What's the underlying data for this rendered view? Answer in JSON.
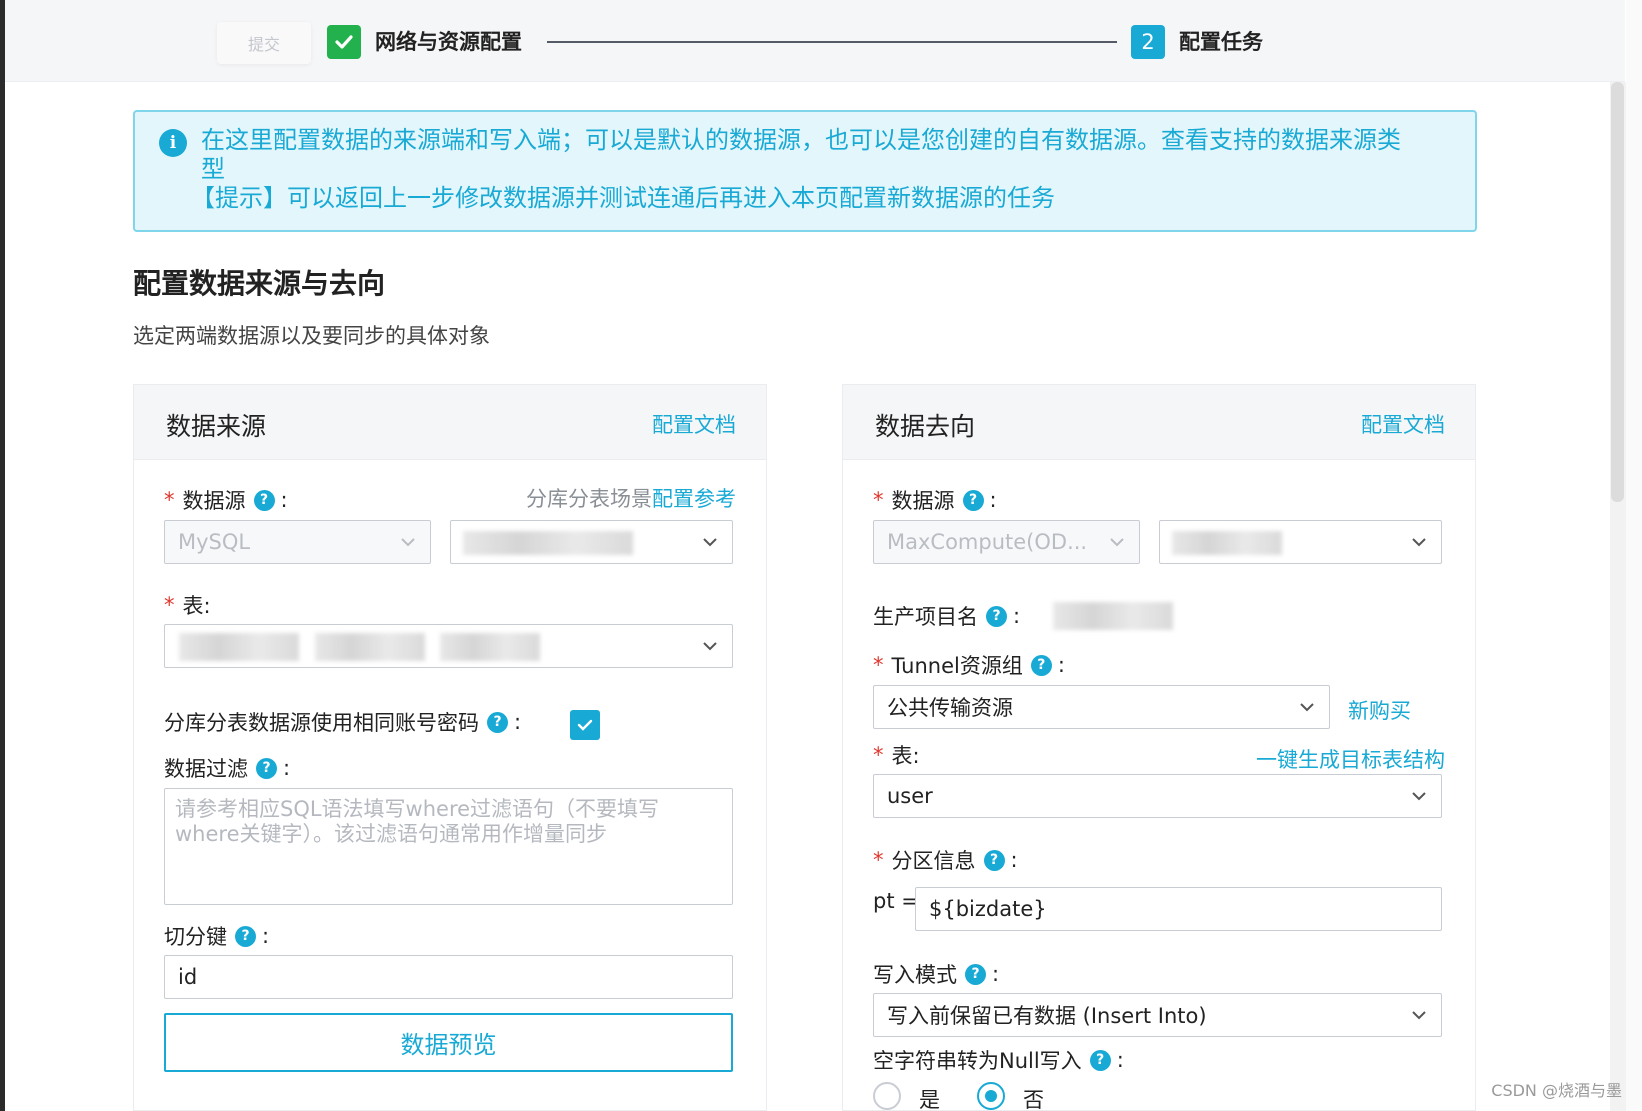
{
  "stepper": {
    "submit_label": "提交",
    "step1_label": "网络与资源配置",
    "step2_number": "2",
    "step2_label": "配置任务"
  },
  "info": {
    "text": "在这里配置数据的来源端和写入端；可以是默认的数据源，也可以是您创建的自有数据源。查看支持的数据来源类型",
    "tip": "【提示】可以返回上一步修改数据源并测试连通后再进入本页配置新数据源的任务"
  },
  "section": {
    "title": "配置数据来源与去向",
    "subtitle": "选定两端数据源以及要同步的具体对象"
  },
  "source": {
    "title": "数据来源",
    "doc_link": "配置文档",
    "datasource_label": "数据源",
    "sharding_hint": "分库分表场景",
    "sharding_link": "配置参考",
    "datasource_type": "MySQL",
    "table_label": "表:",
    "same_account_label": "分库分表数据源使用相同账号密码",
    "filter_label": "数据过滤",
    "filter_placeholder": "请参考相应SQL语法填写where过滤语句（不要填写where关键字）。该过滤语句通常用作增量同步",
    "split_key_label": "切分键",
    "split_key_value": "id",
    "preview_button": "数据预览"
  },
  "target": {
    "title": "数据去向",
    "doc_link": "配置文档",
    "datasource_label": "数据源",
    "datasource_type": "MaxCompute(OD...",
    "project_label": "生产项目名",
    "tunnel_label": "Tunnel资源组",
    "tunnel_value": "公共传输资源",
    "buy_link": "新购买",
    "table_label": "表:",
    "gen_table_link": "一键生成目标表结构",
    "table_value": "user",
    "partition_label": "分区信息",
    "partition_prefix": "pt =",
    "partition_value": "${bizdate}",
    "write_mode_label": "写入模式",
    "write_mode_value": "写入前保留已有数据 (Insert Into)",
    "null_label": "空字符串转为Null写入",
    "radio_yes": "是",
    "radio_no": "否",
    "null_selected": "否"
  },
  "watermark": "CSDN @烧酒与墨",
  "colors": {
    "accent": "#19a9d5",
    "success": "#22b14c",
    "required": "#e0382e"
  },
  "icons": {
    "step1": "check-icon",
    "info": "info-icon",
    "help": "question-icon",
    "select": "chevron-down-icon",
    "checkbox": "check-icon"
  }
}
